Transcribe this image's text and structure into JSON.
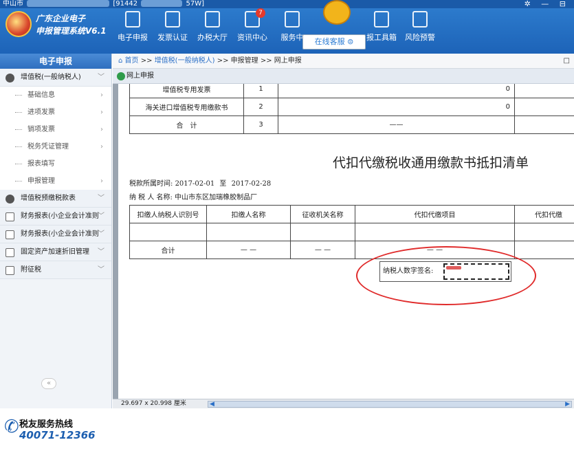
{
  "window": {
    "title_prefix": "中山市",
    "title_code_start": "[91442",
    "title_code_end": "57W]",
    "controls": "✲ — ⊟"
  },
  "brand": {
    "line1": "广东企业电子",
    "line2": "申报管理系统V6.1"
  },
  "topnav": [
    {
      "label": "电子申报",
      "icon": "monitor-icon"
    },
    {
      "label": "发票认证",
      "icon": "invoice-icon"
    },
    {
      "label": "办税大厅",
      "icon": "hall-icon"
    },
    {
      "label": "资讯中心",
      "icon": "message-icon",
      "badge": "7"
    },
    {
      "label": "服务中",
      "icon": "service-icon"
    },
    {
      "label": "报工具箱",
      "icon": "toolbox-icon"
    },
    {
      "label": "风险预警",
      "icon": "warning-icon"
    }
  ],
  "online_service": "在线客服 ⊜",
  "sidebar": {
    "header": "电子申报",
    "sections": [
      {
        "label": "增值税(一般纳税人)",
        "icon": "s-icon",
        "expanded": true,
        "items": [
          "基础信息",
          "进项发票",
          "销项发票",
          "税务凭证管理",
          "报表填写",
          "申报管理"
        ]
      },
      {
        "label": "增值税预缴税款表",
        "icon": "s-icon"
      },
      {
        "label": "财务报表(小企业会计准则",
        "icon": "chart-icon"
      },
      {
        "label": "财务报表(小企业会计准则",
        "icon": "list-icon"
      },
      {
        "label": "固定资产加速折旧管理",
        "icon": "chart-icon"
      },
      {
        "label": "附征税",
        "icon": "building-icon"
      }
    ],
    "collapse": "«",
    "hotline_title": "税友服务热线",
    "hotline_number": "40071-12366"
  },
  "breadcrumb": {
    "home": "首页",
    "sep": ">>",
    "vat": "增值税(一般纳税人)",
    "mgmt": "申报管理",
    "current": "网上申报",
    "close": "□"
  },
  "tab": {
    "label": "网上申报"
  },
  "doc": {
    "top_table": [
      {
        "name": "增值税专用发票",
        "no": "1",
        "value": "0"
      },
      {
        "name": "海关进口增值税专用缴款书",
        "no": "2",
        "value": "0"
      },
      {
        "name": "合　计",
        "no": "3",
        "value": "——"
      }
    ],
    "title": "代扣代缴税收通用缴款书抵扣清单",
    "period_label": "税款所属时间:",
    "period_start": "2017-02-01",
    "period_to": "至",
    "period_end": "2017-02-28",
    "taxpayer_label": "纳 税 人 名称:",
    "taxpayer_name": "中山市东区加瑞橡胶制品厂",
    "headers": [
      "扣缴人纳税人识别号",
      "扣缴人名称",
      "征收机关名称",
      "代扣代缴项目",
      "代扣代缴"
    ],
    "total_row": [
      "合计",
      "— —",
      "— —",
      "— —",
      "—"
    ],
    "sign_label": "纳税人数字签名:"
  },
  "status": {
    "page_size": "29.697 x 20.998 厘米",
    "scroll_left": "◀",
    "scroll_right": "▶"
  }
}
